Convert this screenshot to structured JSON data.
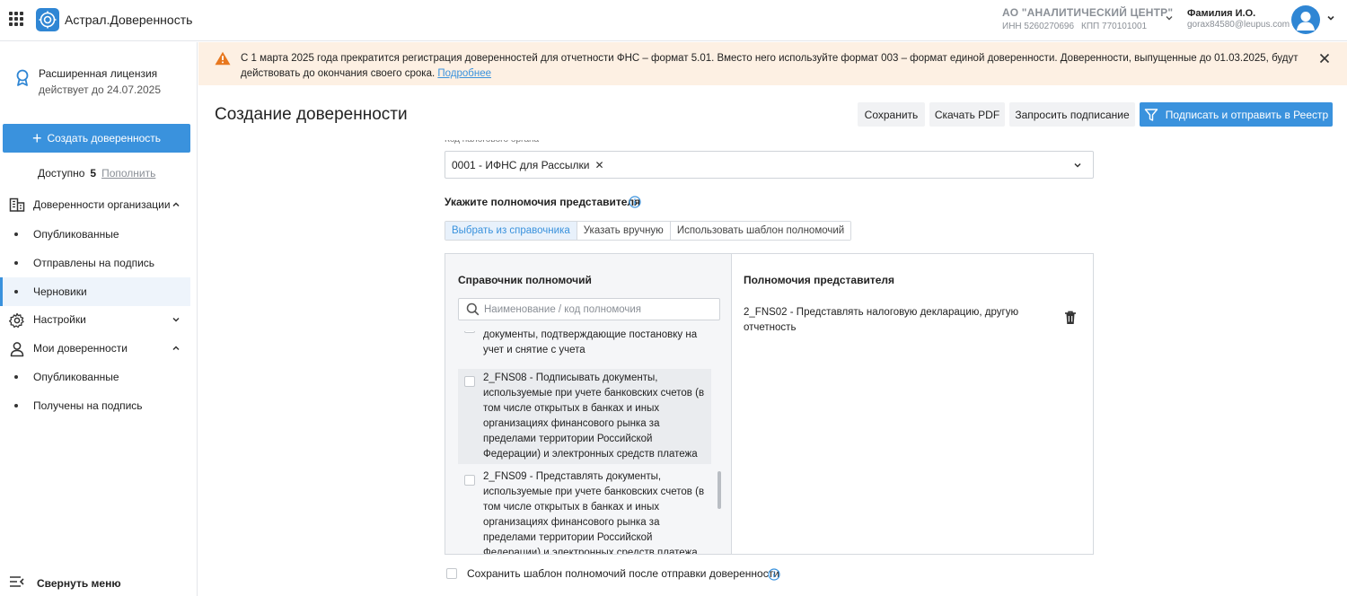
{
  "app": {
    "title": "Астрал.Доверенность"
  },
  "org": {
    "name": "АО \"АНАЛИТИЧЕСКИЙ ЦЕНТР\"",
    "inn": "ИНН 5260270696",
    "kpp": "КПП 770101001"
  },
  "user": {
    "name": "Фамилия И.О.",
    "email": "gorax84580@leupus.com"
  },
  "sidebar": {
    "license_title": "Расширенная лицензия",
    "license_sub": "действует до 24.07.2025",
    "create_button": "Создать доверенность",
    "available_label": "Доступно",
    "available_count": "5",
    "replenish_link": "Пополнить",
    "groups": [
      {
        "label": "Доверенности организации",
        "items": [
          "Опубликованные",
          "Отправлены на подпись",
          "Черновики"
        ]
      },
      {
        "label": "Настройки"
      },
      {
        "label": "Мои доверенности",
        "items": [
          "Опубликованные",
          "Получены на подпись"
        ]
      }
    ],
    "collapse_label": "Свернуть меню"
  },
  "banner": {
    "text": "С 1 марта 2025 года прекратится регистрация доверенностей для отчетности ФНС – формат 5.01. Вместо него используйте формат 003 – формат единой доверенности. Доверенности, выпущенные до 01.03.2025, будут действовать до окончания своего срока.",
    "link": "Подробнее"
  },
  "header": {
    "title": "Создание доверенности",
    "buttons": {
      "save": "Сохранить",
      "pdf": "Скачать PDF",
      "request": "Запросить подписание",
      "sign_send": "Подписать и отправить в Реестр"
    }
  },
  "form": {
    "tax_label": "Код налогового органа",
    "tax_value": "0001 - ИФНС для Рассылки",
    "powers_label": "Укажите полномочия представителя",
    "tabs": [
      "Выбрать из справочника",
      "Указать вручную",
      "Использовать шаблон полномочий"
    ],
    "catalog_title": "Справочник полномочий",
    "search_placeholder": "Наименование / код полномочия",
    "catalog_items": [
      "документы, подтверждающие постановку на учет и снятие с учета",
      "2_FNS08 - Подписывать документы, используемые при учете банковских счетов (в том числе открытых в банках и иных организациях финансового рынка за пределами территории Российской Федерации) и электронных средств платежа",
      "2_FNS09 - Представлять документы, используемые при учете банковских счетов (в том числе открытых в банках и иных организациях финансового рынка за пределами территории Российской Федерации) и электронных средств платежа"
    ],
    "selected_title": "Полномочия представителя",
    "selected_items": [
      "2_FNS02 - Представлять налоговую декларацию, другую отчетность"
    ],
    "save_template_label": "Сохранить шаблон полномочий после отправки доверенности"
  }
}
